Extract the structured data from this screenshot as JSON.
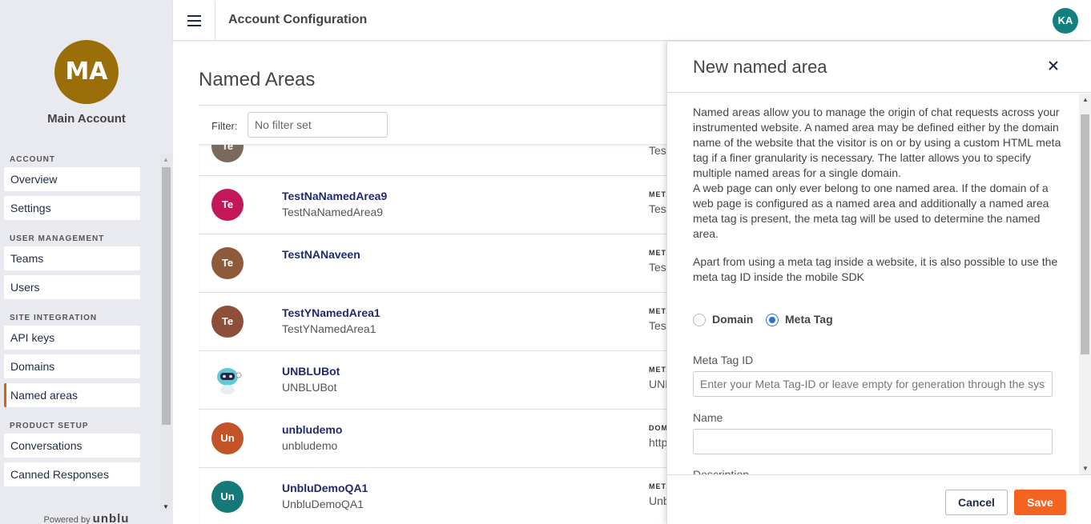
{
  "header": {
    "title": "Account Configuration",
    "user_initials": "KA"
  },
  "sidebar": {
    "account_initials": "MA",
    "account_name": "Main Account",
    "sections": [
      {
        "title": "ACCOUNT",
        "items": [
          "Overview",
          "Settings"
        ]
      },
      {
        "title": "USER MANAGEMENT",
        "items": [
          "Teams",
          "Users"
        ]
      },
      {
        "title": "SITE INTEGRATION",
        "items": [
          "API keys",
          "Domains",
          "Named areas"
        ]
      },
      {
        "title": "PRODUCT SETUP",
        "items": [
          "Conversations",
          "Canned Responses"
        ]
      }
    ],
    "active_item": "Named areas",
    "footer_powered": "Powered by",
    "footer_brand": "unblu"
  },
  "main": {
    "title": "Named Areas",
    "filter_label": "Filter:",
    "filter_placeholder": "No filter set",
    "rows": [
      {
        "initials": "Te",
        "color": "#7a6a5c",
        "title": "",
        "subtitle": "",
        "type": "",
        "value": "Tes"
      },
      {
        "initials": "Te",
        "color": "#c2185b",
        "title": "TestNaNamedArea9",
        "subtitle": "TestNaNamedArea9",
        "type": "METATAG",
        "value": "Tes"
      },
      {
        "initials": "Te",
        "color": "#8d5a3c",
        "title": "TestNANaveen",
        "subtitle": "",
        "type": "METATAG",
        "value": "Tes"
      },
      {
        "initials": "Te",
        "color": "#8d4f3a",
        "title": "TestYNamedArea1",
        "subtitle": "TestYNamedArea1",
        "type": "METATAG",
        "value": "Tes"
      },
      {
        "initials": "",
        "color": "#ffffff",
        "title": "UNBLUBot",
        "subtitle": "UNBLUBot",
        "type": "METATAG",
        "value": "UNB",
        "bot": true
      },
      {
        "initials": "Un",
        "color": "#c4532a",
        "title": "unbludemo",
        "subtitle": "unbludemo",
        "type": "DOMAIN",
        "value": "http"
      },
      {
        "initials": "Un",
        "color": "#15797a",
        "title": "UnbluDemoQA1",
        "subtitle": "UnbluDemoQA1",
        "type": "METATAG",
        "value": "Unb"
      }
    ]
  },
  "panel": {
    "title": "New named area",
    "description_1": "Named areas allow you to manage the origin of chat requests across your instrumented website. A named area may be defined either by the domain name of the website that the visitor is on or by using a custom HTML meta tag if a finer granularity is necessary. The latter allows you to specify multiple named areas for a single domain.",
    "description_2": "A web page can only ever belong to one named area. If the domain of a web page is configured as a named area and additionally a named area meta tag is present, the meta tag will be used to determine the named area.",
    "description_3": "Apart from using a meta tag inside a website, it is also possible to use the meta tag ID inside the mobile SDK",
    "radio_domain": "Domain",
    "radio_metatag": "Meta Tag",
    "selected_type": "Meta Tag",
    "meta_tag_label": "Meta Tag ID",
    "meta_tag_placeholder": "Enter your Meta Tag-ID or leave empty for generation through the system",
    "name_label": "Name",
    "name_value": "",
    "description_label": "Description",
    "cancel_label": "Cancel",
    "save_label": "Save"
  },
  "colors": {
    "accent": "#f4631f",
    "active_nav": "#e05a1c",
    "link": "#1f2a6e"
  }
}
